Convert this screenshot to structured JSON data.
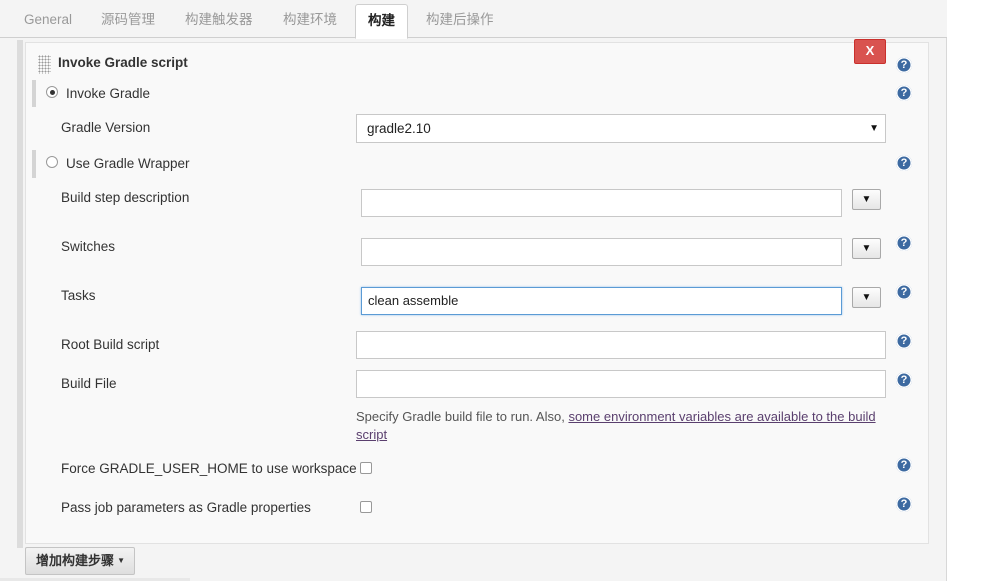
{
  "tabs": [
    {
      "label": "General",
      "active": false
    },
    {
      "label": "源码管理",
      "active": false
    },
    {
      "label": "构建触发器",
      "active": false
    },
    {
      "label": "构建环境",
      "active": false
    },
    {
      "label": "构建",
      "active": true
    },
    {
      "label": "构建后操作",
      "active": false
    }
  ],
  "section": {
    "title": "Invoke Gradle script",
    "close_label": "X"
  },
  "help_glyph": "?",
  "options": {
    "invoke_gradle": {
      "label": "Invoke Gradle",
      "checked": true
    },
    "use_wrapper": {
      "label": "Use Gradle Wrapper",
      "checked": false
    }
  },
  "gradle_version": {
    "label": "Gradle Version",
    "selected": "gradle2.10"
  },
  "fields": {
    "build_step_description": {
      "label": "Build step description",
      "value": ""
    },
    "switches": {
      "label": "Switches",
      "value": ""
    },
    "tasks": {
      "label": "Tasks",
      "value": "clean assemble"
    },
    "root_build_script": {
      "label": "Root Build script",
      "value": ""
    },
    "build_file": {
      "label": "Build File",
      "value": ""
    }
  },
  "build_file_help": {
    "text": "Specify Gradle build file to run. Also, ",
    "link": "some environment variables are available to the build script"
  },
  "checkboxes": {
    "force_user_home": {
      "label": "Force GRADLE_USER_HOME to use workspace",
      "checked": false
    },
    "pass_params": {
      "label": "Pass job parameters as Gradle properties",
      "checked": false
    }
  },
  "add_step": {
    "label": "增加构建步骤"
  },
  "colors": {
    "close_button": "#d9534f",
    "help_icon": "#3d6aa1",
    "link": "#5a3f6e",
    "focus_border": "#5b9bd5"
  }
}
